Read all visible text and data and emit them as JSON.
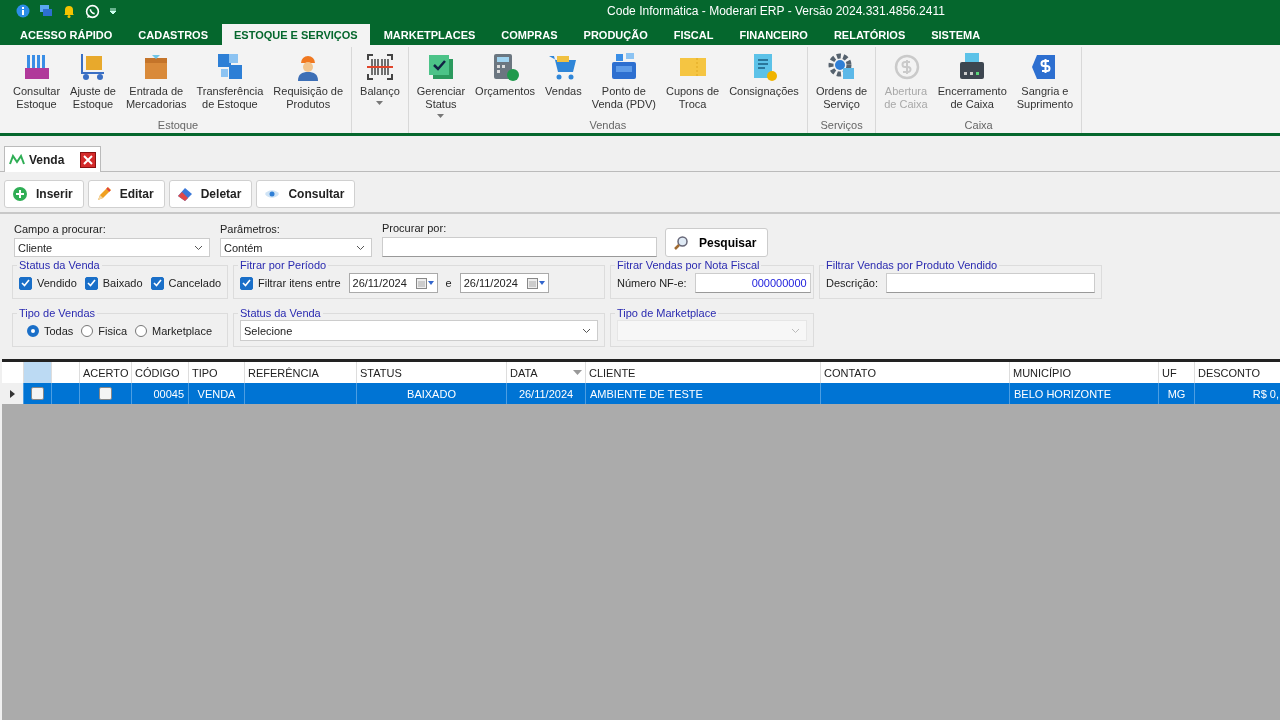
{
  "window": {
    "title": "Code Informática - Moderari ERP - Versão 2024.331.4856.2411"
  },
  "menu_tabs": [
    {
      "label": "ACESSO RÁPIDO",
      "selected": false
    },
    {
      "label": "CADASTROS",
      "selected": false
    },
    {
      "label": "ESTOQUE E SERVIÇOS",
      "selected": true
    },
    {
      "label": "MARKETPLACES",
      "selected": false
    },
    {
      "label": "COMPRAS",
      "selected": false
    },
    {
      "label": "PRODUÇÃO",
      "selected": false
    },
    {
      "label": "FISCAL",
      "selected": false
    },
    {
      "label": "FINANCEIRO",
      "selected": false
    },
    {
      "label": "RELATÓRIOS",
      "selected": false
    },
    {
      "label": "SISTEMA",
      "selected": false
    }
  ],
  "ribbon": [
    {
      "label": "Estoque",
      "buttons": [
        {
          "label": "Consultar\nEstoque",
          "disabled": false,
          "dropdown": false
        },
        {
          "label": "Ajuste de\nEstoque",
          "disabled": false,
          "dropdown": false
        },
        {
          "label": "Entrada de\nMercadorias",
          "disabled": false,
          "dropdown": false
        },
        {
          "label": "Transferência\nde Estoque",
          "disabled": false,
          "dropdown": false
        },
        {
          "label": "Requisição de\nProdutos",
          "disabled": false,
          "dropdown": false
        }
      ]
    },
    {
      "buttons": [
        {
          "label": "Balanço",
          "disabled": false,
          "dropdown": true
        }
      ]
    },
    {
      "label": "Vendas",
      "buttons": [
        {
          "label": "Gerenciar\nStatus",
          "disabled": false,
          "dropdown": true
        },
        {
          "label": "Orçamentos",
          "disabled": false,
          "dropdown": false
        },
        {
          "label": "Vendas",
          "disabled": false,
          "dropdown": false
        },
        {
          "label": "Ponto de\nVenda (PDV)",
          "disabled": false,
          "dropdown": false
        },
        {
          "label": "Cupons de\nTroca",
          "disabled": false,
          "dropdown": false
        },
        {
          "label": "Consignações",
          "disabled": false,
          "dropdown": false
        }
      ]
    },
    {
      "label": "Serviços",
      "buttons": [
        {
          "label": "Ordens de\nServiço",
          "disabled": false,
          "dropdown": false
        }
      ]
    },
    {
      "label": "Caixa",
      "buttons": [
        {
          "label": "Abertura\nde Caixa",
          "disabled": true,
          "dropdown": false
        },
        {
          "label": "Encerramento\nde Caixa",
          "disabled": false,
          "dropdown": false
        },
        {
          "label": "Sangria e\nSuprimento",
          "disabled": false,
          "dropdown": false
        }
      ]
    }
  ],
  "document_tab": {
    "label": "Venda"
  },
  "toolbar": [
    "Inserir",
    "Editar",
    "Deletar",
    "Consultar"
  ],
  "search": {
    "field": {
      "label": "Campo a procurar:",
      "value": "Cliente"
    },
    "parameters": {
      "label": "Parâmetros:",
      "value": "Contém"
    },
    "query": {
      "label": "Procurar por:"
    },
    "button": "Pesquisar"
  },
  "sale_status": {
    "title": "Status da Venda",
    "options": [
      {
        "label": "Vendido",
        "checked": true
      },
      {
        "label": "Baixado",
        "checked": true
      },
      {
        "label": "Cancelado",
        "checked": true
      }
    ]
  },
  "period": {
    "title": "Fitrar por Período",
    "filter": {
      "label": "Filtrar itens entre",
      "checked": true
    },
    "from": "26/11/2024",
    "separator": "e",
    "to": "26/11/2024"
  },
  "invoice": {
    "title": "Fitrar Vendas por Nota Fiscal",
    "label": "Número NF-e:",
    "value": "000000000"
  },
  "product": {
    "title": "Filtrar Vendas por Produto Vendido",
    "label": "Descrição:"
  },
  "sale_type": {
    "title": "Tipo de Vendas",
    "options": [
      {
        "label": "Todas",
        "selected": true
      },
      {
        "label": "Fisica",
        "selected": false
      },
      {
        "label": "Marketplace",
        "selected": false
      }
    ]
  },
  "status_select": {
    "title": "Status da Venda",
    "value": "Selecione"
  },
  "marketplace_type": {
    "title": "Tipo de Marketplace",
    "disabled": true
  },
  "table": {
    "columns": [
      {
        "label": "ACERTO"
      },
      {
        "label": "CÓDIGO"
      },
      {
        "label": "TIPO"
      },
      {
        "label": "REFERÊNCIA"
      },
      {
        "label": "STATUS"
      },
      {
        "label": "DATA",
        "sorted": true
      },
      {
        "label": "CLIENTE"
      },
      {
        "label": "CONTATO"
      },
      {
        "label": "MUNICÍPIO"
      },
      {
        "label": "UF"
      },
      {
        "label": "DESCONTO"
      }
    ],
    "rows": [
      {
        "selected": true,
        "checked": false,
        "acerto": false,
        "codigo": "00045",
        "tipo": "VENDA",
        "status": "BAIXADO",
        "data": "26/11/2024",
        "cliente": "AMBIENTE DE TESTE",
        "municipio": "BELO HORIZONTE",
        "uf": "MG",
        "desconto": "R$ 0,"
      }
    ]
  }
}
